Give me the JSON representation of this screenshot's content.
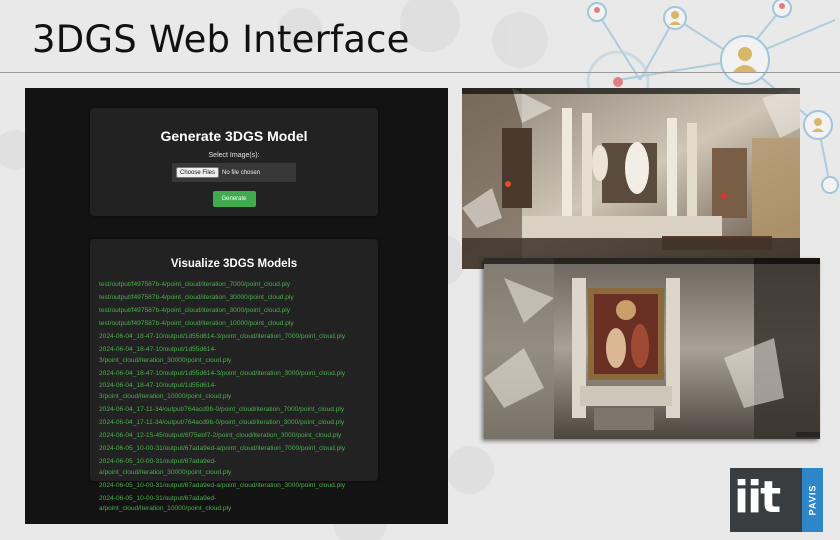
{
  "slide": {
    "title": "3DGS Web Interface"
  },
  "generate": {
    "heading": "Generate 3DGS Model",
    "select_label": "Select Image(s):",
    "choose_files_label": "Choose Files",
    "file_status": "No file chosen",
    "generate_button": "Generate"
  },
  "visualize": {
    "heading": "Visualize 3DGS Models",
    "models": [
      "test/output/f497587b-4/point_cloud/iteration_7000/point_cloud.ply",
      "test/output/f497587b-4/point_cloud/iteration_30000/point_cloud.ply",
      "test/output/f497587b-4/point_cloud/iteration_3000/point_cloud.ply",
      "test/output/f497587b-4/point_cloud/iteration_10000/point_cloud.ply",
      "2024-06-04_18-47-10/output/1d55d614-3/point_cloud/iteration_7000/point_cloud.ply",
      "2024-06-04_18-47-10/output/1d55d614-\n3/point_cloud/iteration_30000/point_cloud.ply",
      "2024-06-04_18-47-10/output/1d55d614-3/point_cloud/iteration_3000/point_cloud.ply",
      "2024-06-04_18-47-10/output/1d55d614-\n3/point_cloud/iteration_10000/point_cloud.ply",
      "2024-06-04_17-11-34/output/764acd9b-0/point_cloud/iteration_7000/point_cloud.ply",
      "2024-06-04_17-11-34/output/764acd9b-0/point_cloud/iteration_3000/point_cloud.ply",
      "2024-06-04_12-15-45/output/6f75ebf7-2/point_cloud/iteration_3000/point_cloud.ply",
      "2024-06-05_10-00-31/output/67ada9ed-a/point_cloud/iteration_7000/point_cloud.ply",
      "2024-06-05_10-00-31/output/67ada9ed-\na/point_cloud/iteration_30000/point_cloud.ply",
      "2024-06-05_10-00-31/output/67ada9ed-a/point_cloud/iteration_3000/point_cloud.ply",
      "2024-06-05_10-00-31/output/67ada9ed-\na/point_cloud/iteration_10000/point_cloud.ply"
    ]
  },
  "logo": {
    "text": "iit",
    "side_text": "PAVIS"
  },
  "colors": {
    "accent_green": "#3faa4e",
    "link_green": "#4cae50",
    "panel_bg": "#131313",
    "card_bg": "#222222",
    "logo_blue": "#2c86c8"
  }
}
